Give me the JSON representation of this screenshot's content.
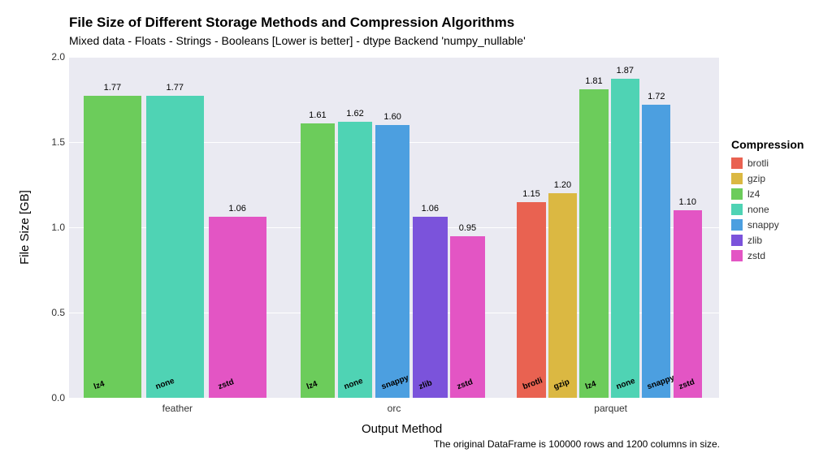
{
  "chart_data": {
    "type": "bar",
    "title": "File Size of Different Storage Methods and Compression Algorithms",
    "subtitle": "Mixed data - Floats - Strings - Booleans [Lower is better] - dtype Backend 'numpy_nullable'",
    "xlabel": "Output Method",
    "ylabel": "File Size [GB]",
    "caption": "The original DataFrame is 100000 rows and 1200 columns in size.",
    "ylim": [
      0.0,
      2.0
    ],
    "yticks": [
      0.0,
      0.5,
      1.0,
      1.5,
      2.0
    ],
    "legend_title": "Compression",
    "compression_colors": {
      "brotli": "#e96251",
      "gzip": "#dbb842",
      "lz4": "#6ccc5b",
      "none": "#4fd3b4",
      "snappy": "#4c9fe0",
      "zlib": "#7b53db",
      "zstd": "#e355c4"
    },
    "legend_order": [
      "brotli",
      "gzip",
      "lz4",
      "none",
      "snappy",
      "zlib",
      "zstd"
    ],
    "groups": [
      {
        "name": "feather",
        "bars": [
          {
            "compression": "lz4",
            "value": 1.77
          },
          {
            "compression": "none",
            "value": 1.77
          },
          {
            "compression": "zstd",
            "value": 1.06
          }
        ]
      },
      {
        "name": "orc",
        "bars": [
          {
            "compression": "lz4",
            "value": 1.61
          },
          {
            "compression": "none",
            "value": 1.62
          },
          {
            "compression": "snappy",
            "value": 1.6
          },
          {
            "compression": "zlib",
            "value": 1.06
          },
          {
            "compression": "zstd",
            "value": 0.95
          }
        ]
      },
      {
        "name": "parquet",
        "bars": [
          {
            "compression": "brotli",
            "value": 1.15
          },
          {
            "compression": "gzip",
            "value": 1.2
          },
          {
            "compression": "lz4",
            "value": 1.81
          },
          {
            "compression": "none",
            "value": 1.87
          },
          {
            "compression": "snappy",
            "value": 1.72
          },
          {
            "compression": "zstd",
            "value": 1.1
          }
        ]
      }
    ]
  }
}
